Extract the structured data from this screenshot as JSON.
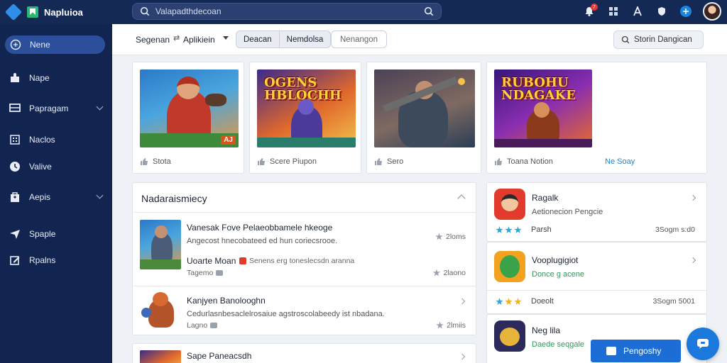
{
  "app": {
    "name": "Napluioa"
  },
  "search": {
    "placeholder": "Valapadthdecoan"
  },
  "top": {
    "notif_badge": "7"
  },
  "sidebar": {
    "items": [
      {
        "label": "Nene",
        "icon": "compass-icon",
        "active": true
      },
      {
        "label": "Nape",
        "icon": "puzzle-icon"
      },
      {
        "label": "Papragam",
        "icon": "monitor-icon",
        "chevron": true
      },
      {
        "label": "Naclos",
        "icon": "grid-list-icon"
      },
      {
        "label": "Valive",
        "icon": "clock-icon"
      },
      {
        "label": "Aepis",
        "icon": "bag-icon",
        "chevron": true
      },
      {
        "label": "Spaple",
        "icon": "paper-plane-icon"
      },
      {
        "label": "Rpalns",
        "icon": "edit-icon"
      }
    ]
  },
  "filters": {
    "sort_label": "Segenan",
    "sort_sep": "⇄",
    "sort_value": "Aplikiein",
    "seg": [
      "Deacan",
      "Nemdolsa"
    ],
    "seg3": "Nenangon",
    "right": "Storin Dangican"
  },
  "featured": [
    {
      "title": "",
      "foot": "Stota",
      "corner": "AJ"
    },
    {
      "title": "OGENS HBLOCHH",
      "foot": "Scere Piupon"
    },
    {
      "title": "",
      "foot": "Sero"
    },
    {
      "title": "RUBOHU NDAGAKE",
      "foot": "Toana Notion"
    }
  ],
  "featured_link": "Ne Soay",
  "recommend": {
    "title": "Nadaraismiecy",
    "rows": [
      {
        "title": "Vanesak Fove Pelaeobbamele hkeoge",
        "desc": "Angecost hnecobateed ed hun coriecsrooe.",
        "rating": "2loms",
        "sub_title": "Uoarte Moan",
        "sub_desc": "Senens erg toneslecsdn aranna",
        "sub_meta": "Tagemo",
        "sub_rating": "2laono"
      },
      {
        "title": "Kanjyen Banolooghn",
        "desc": "Cedurlasnbesaclelrosaiue agstroscolabeedy ist nbadana.",
        "meta": "Lagno",
        "rating": "2lmiis"
      },
      {
        "title": "Sape Paneacsdh"
      }
    ]
  },
  "apps": [
    {
      "name": "Ragalk",
      "sub": "Aetionecion Pengcie",
      "stat": "Parsh",
      "size": "3Sogm s:d0",
      "sub_color": "gray",
      "stars": [
        "#2aa7d9",
        "#2aa7d9",
        "#2aa7d9"
      ]
    },
    {
      "name": "Vooplugigiot",
      "sub": "Donce g acene",
      "stat": "Doeolt",
      "size": "3Sogm 5001",
      "sub_color": "green",
      "stars": [
        "#2aa7d9",
        "#f2b01e",
        "#f2b01e"
      ]
    },
    {
      "name": "Neg lila",
      "sub": "Daede seqgale",
      "stat": "",
      "size": "",
      "sub_color": "green",
      "stars": []
    }
  ],
  "cta": {
    "label": "Pengoshy"
  },
  "colors": {
    "topbar": "#142a55",
    "sidebar": "#122550",
    "accent": "#1c6ed6",
    "active_nav": "#2b4f9a"
  }
}
